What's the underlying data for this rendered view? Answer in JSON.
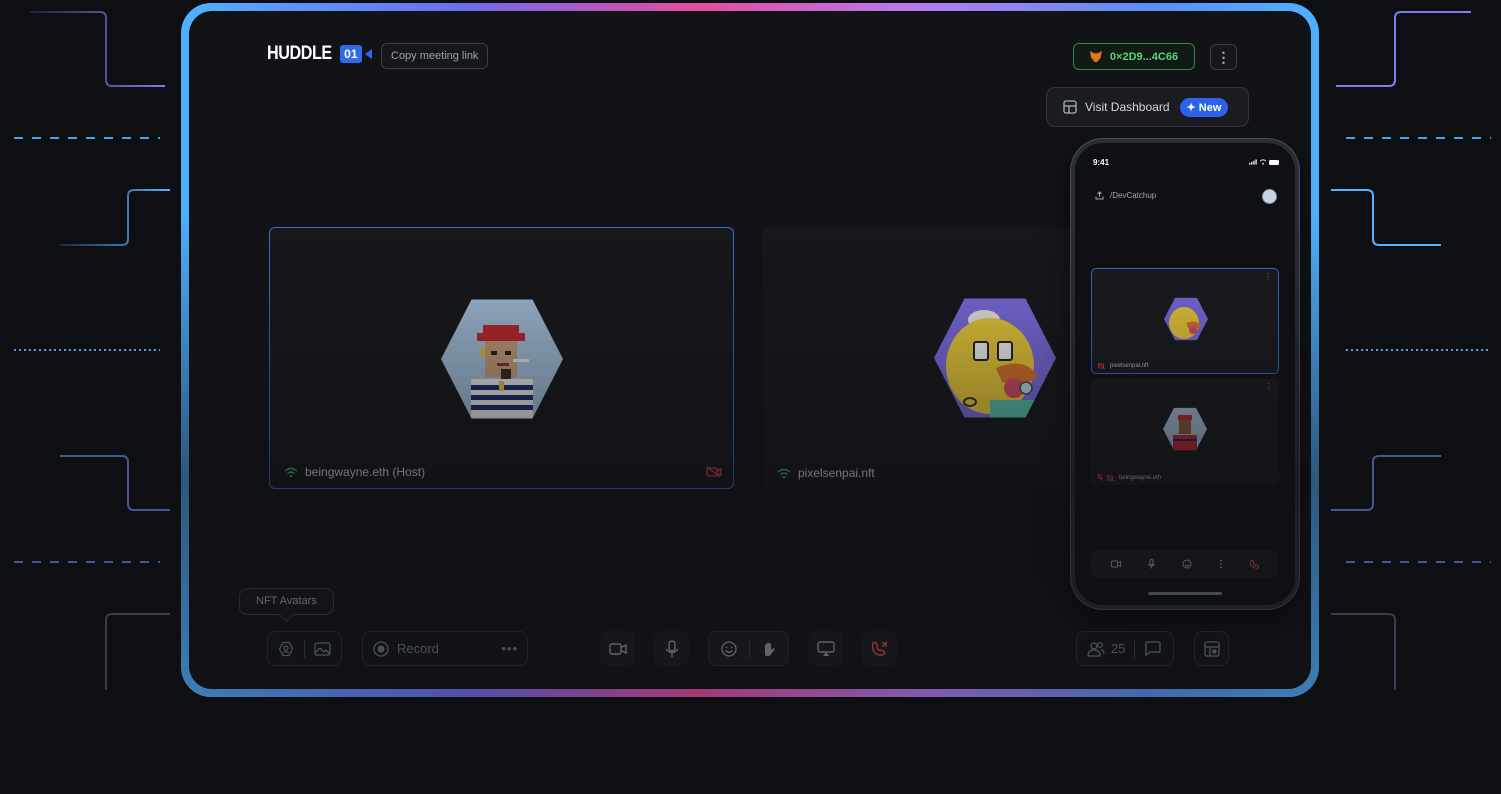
{
  "header": {
    "logo_word": "HUDDLE",
    "logo_badge": "01",
    "copy_link_label": "Copy meeting link",
    "wallet_address": "0×2D9...4C66",
    "more_label": "⋮"
  },
  "dashboard_menu": {
    "visit_label": "Visit Dashboard",
    "new_badge": "✦ New"
  },
  "tiles": [
    {
      "name": "beingwayne.eth (Host)",
      "avatar_color": "#a8c3de"
    },
    {
      "name": "pixelsenpai.nft",
      "avatar_color": "#7f6fe8"
    }
  ],
  "phone": {
    "time": "9:41",
    "room": "/DevCatchup",
    "tiles": [
      {
        "name": "pixelsenpai.nft"
      },
      {
        "name": "beingwayne.eth"
      }
    ],
    "more_label": "⋮"
  },
  "toolbar": {
    "tooltip": "NFT Avatars",
    "record_label": "Record",
    "record_more": "•••",
    "participants_count": "25"
  },
  "colors": {
    "accent_blue": "#2b63e8",
    "wallet_green": "#56d47a",
    "danger_red": "#e5484d",
    "signal_green": "#3fc46b"
  }
}
